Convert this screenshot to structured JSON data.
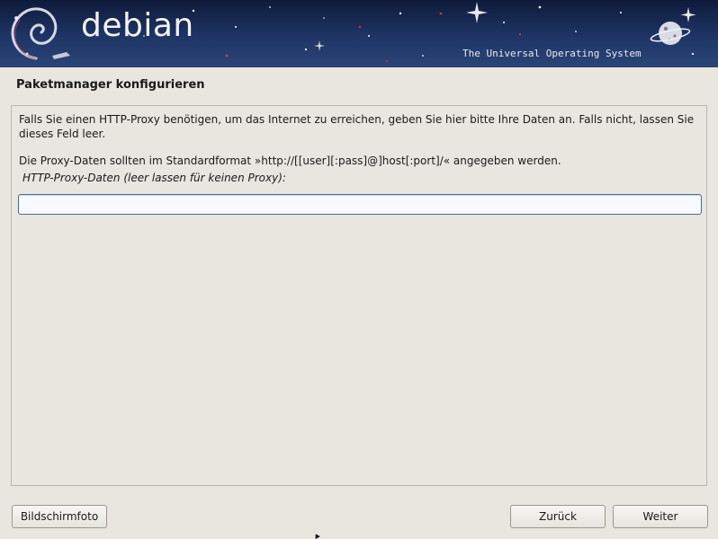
{
  "banner": {
    "logo_text": "debian",
    "tagline": "The Universal Operating System"
  },
  "page": {
    "title": "Paketmanager konfigurieren"
  },
  "main": {
    "paragraph1": "Falls Sie einen HTTP-Proxy benötigen, um das Internet zu erreichen, geben Sie hier bitte Ihre Daten an. Falls nicht, lassen Sie dieses Feld leer.",
    "paragraph2": "Die Proxy-Daten sollten im Standardformat »http://[[user][:pass]@]host[:port]/« angegeben werden.",
    "field_label": "HTTP-Proxy-Daten (leer lassen für keinen Proxy):",
    "proxy_value": ""
  },
  "footer": {
    "screenshot_label": "Bildschirmfoto",
    "back_label": "Zurück",
    "continue_label": "Weiter"
  }
}
